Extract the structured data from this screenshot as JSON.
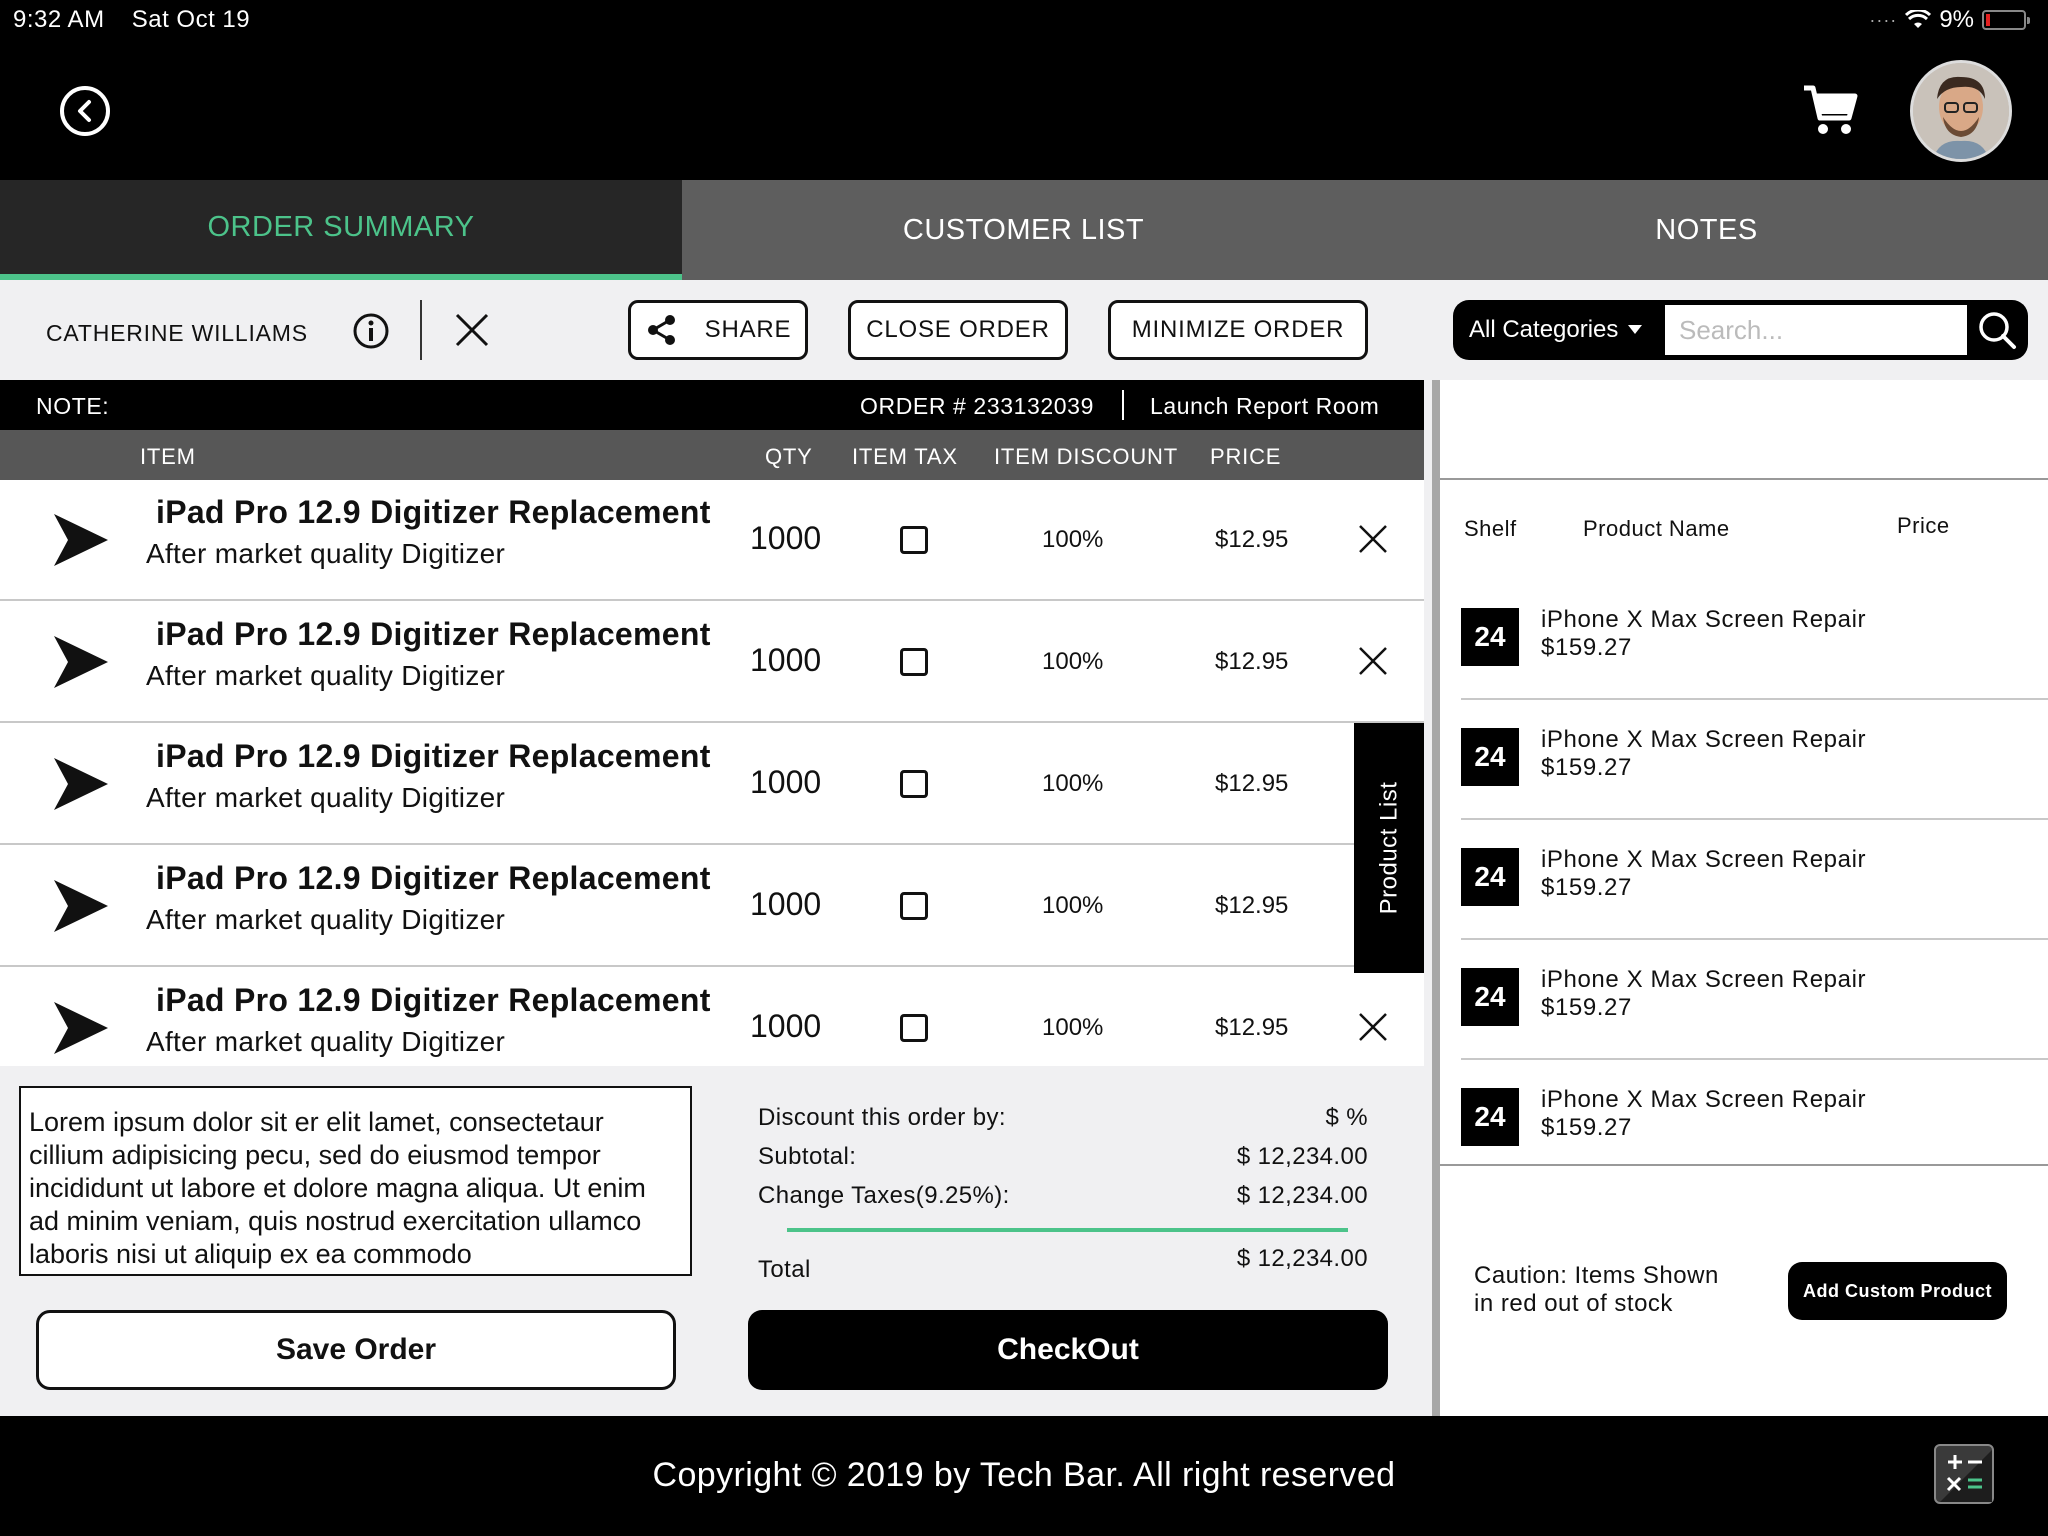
{
  "status_bar": {
    "time": "9:32 AM",
    "date": "Sat Oct 19",
    "battery": "9%"
  },
  "tabs": [
    {
      "label": "ORDER SUMMARY"
    },
    {
      "label": "CUSTOMER LIST"
    },
    {
      "label": "NOTES"
    }
  ],
  "toolbar": {
    "customer_name": "CATHERINE WILLIAMS",
    "share_label": "SHARE",
    "close_order_label": "CLOSE ORDER",
    "minimize_order_label": "MINIMIZE ORDER",
    "category": "All Categories",
    "search_placeholder": "Search..."
  },
  "note_bar": {
    "note_label": "NOTE:",
    "order_number": "ORDER # 233132039",
    "report_room": "Launch Report Room"
  },
  "columns": {
    "item": "ITEM",
    "qty": "QTY",
    "item_tax": "ITEM TAX",
    "item_discount": "ITEM DISCOUNT",
    "price": "PRICE"
  },
  "order_items": [
    {
      "title": "iPad Pro 12.9 Digitizer Replacement",
      "subtitle": "After market quality Digitizer",
      "qty": "1000",
      "discount": "100%",
      "price": "$12.95"
    },
    {
      "title": "iPad Pro 12.9 Digitizer Replacement",
      "subtitle": "After market quality Digitizer",
      "qty": "1000",
      "discount": "100%",
      "price": "$12.95"
    },
    {
      "title": "iPad Pro 12.9 Digitizer Replacement",
      "subtitle": "After market quality Digitizer",
      "qty": "1000",
      "discount": "100%",
      "price": "$12.95"
    },
    {
      "title": "iPad Pro 12.9 Digitizer Replacement",
      "subtitle": "After market quality Digitizer",
      "qty": "1000",
      "discount": "100%",
      "price": "$12.95"
    },
    {
      "title": "iPad Pro 12.9 Digitizer Replacement",
      "subtitle": "After market quality Digitizer",
      "qty": "1000",
      "discount": "100%",
      "price": "$12.95"
    }
  ],
  "product_list_tab": "Product List",
  "order_notes": "Lorem ipsum dolor sit er elit lamet, consectetaur cillium adipisicing pecu, sed do eiusmod tempor incididunt ut labore et dolore magna aliqua. Ut enim ad minim veniam, quis nostrud exercitation ullamco laboris nisi ut aliquip ex ea commodo",
  "summary": {
    "discount_label": "Discount this order by:",
    "discount_value": "$ %",
    "subtotal_label": "Subtotal:",
    "subtotal_value": "$ 12,234.00",
    "taxes_label": "Change Taxes(9.25%):",
    "taxes_value": "$ 12,234.00",
    "total_label": "Total",
    "total_value": "$ 12,234.00"
  },
  "buttons": {
    "save": "Save Order",
    "checkout": "CheckOut",
    "add_custom": "Add Custom Product"
  },
  "product_panel": {
    "headers": {
      "shelf": "Shelf",
      "name": "Product Name",
      "price": "Price"
    },
    "products": [
      {
        "shelf": "24",
        "name": "iPhone X Max Screen Repair",
        "price": "$159.27"
      },
      {
        "shelf": "24",
        "name": "iPhone X Max Screen Repair",
        "price": "$159.27"
      },
      {
        "shelf": "24",
        "name": "iPhone X Max Screen Repair",
        "price": "$159.27"
      },
      {
        "shelf": "24",
        "name": "iPhone X Max Screen Repair",
        "price": "$159.27"
      },
      {
        "shelf": "24",
        "name": "iPhone X Max Screen Repair",
        "price": "$159.27"
      }
    ],
    "caution_line1": "Caution:  Items Shown",
    "caution_line2": "in red out of stock"
  },
  "footer": {
    "copyright": "Copyright © 2019 by Tech Bar. All right reserved"
  },
  "colors": {
    "accent": "#4cc38a",
    "header_bg": "#000000",
    "tab_bg": "#5e5e5e",
    "active_tab_bg": "#262626"
  }
}
